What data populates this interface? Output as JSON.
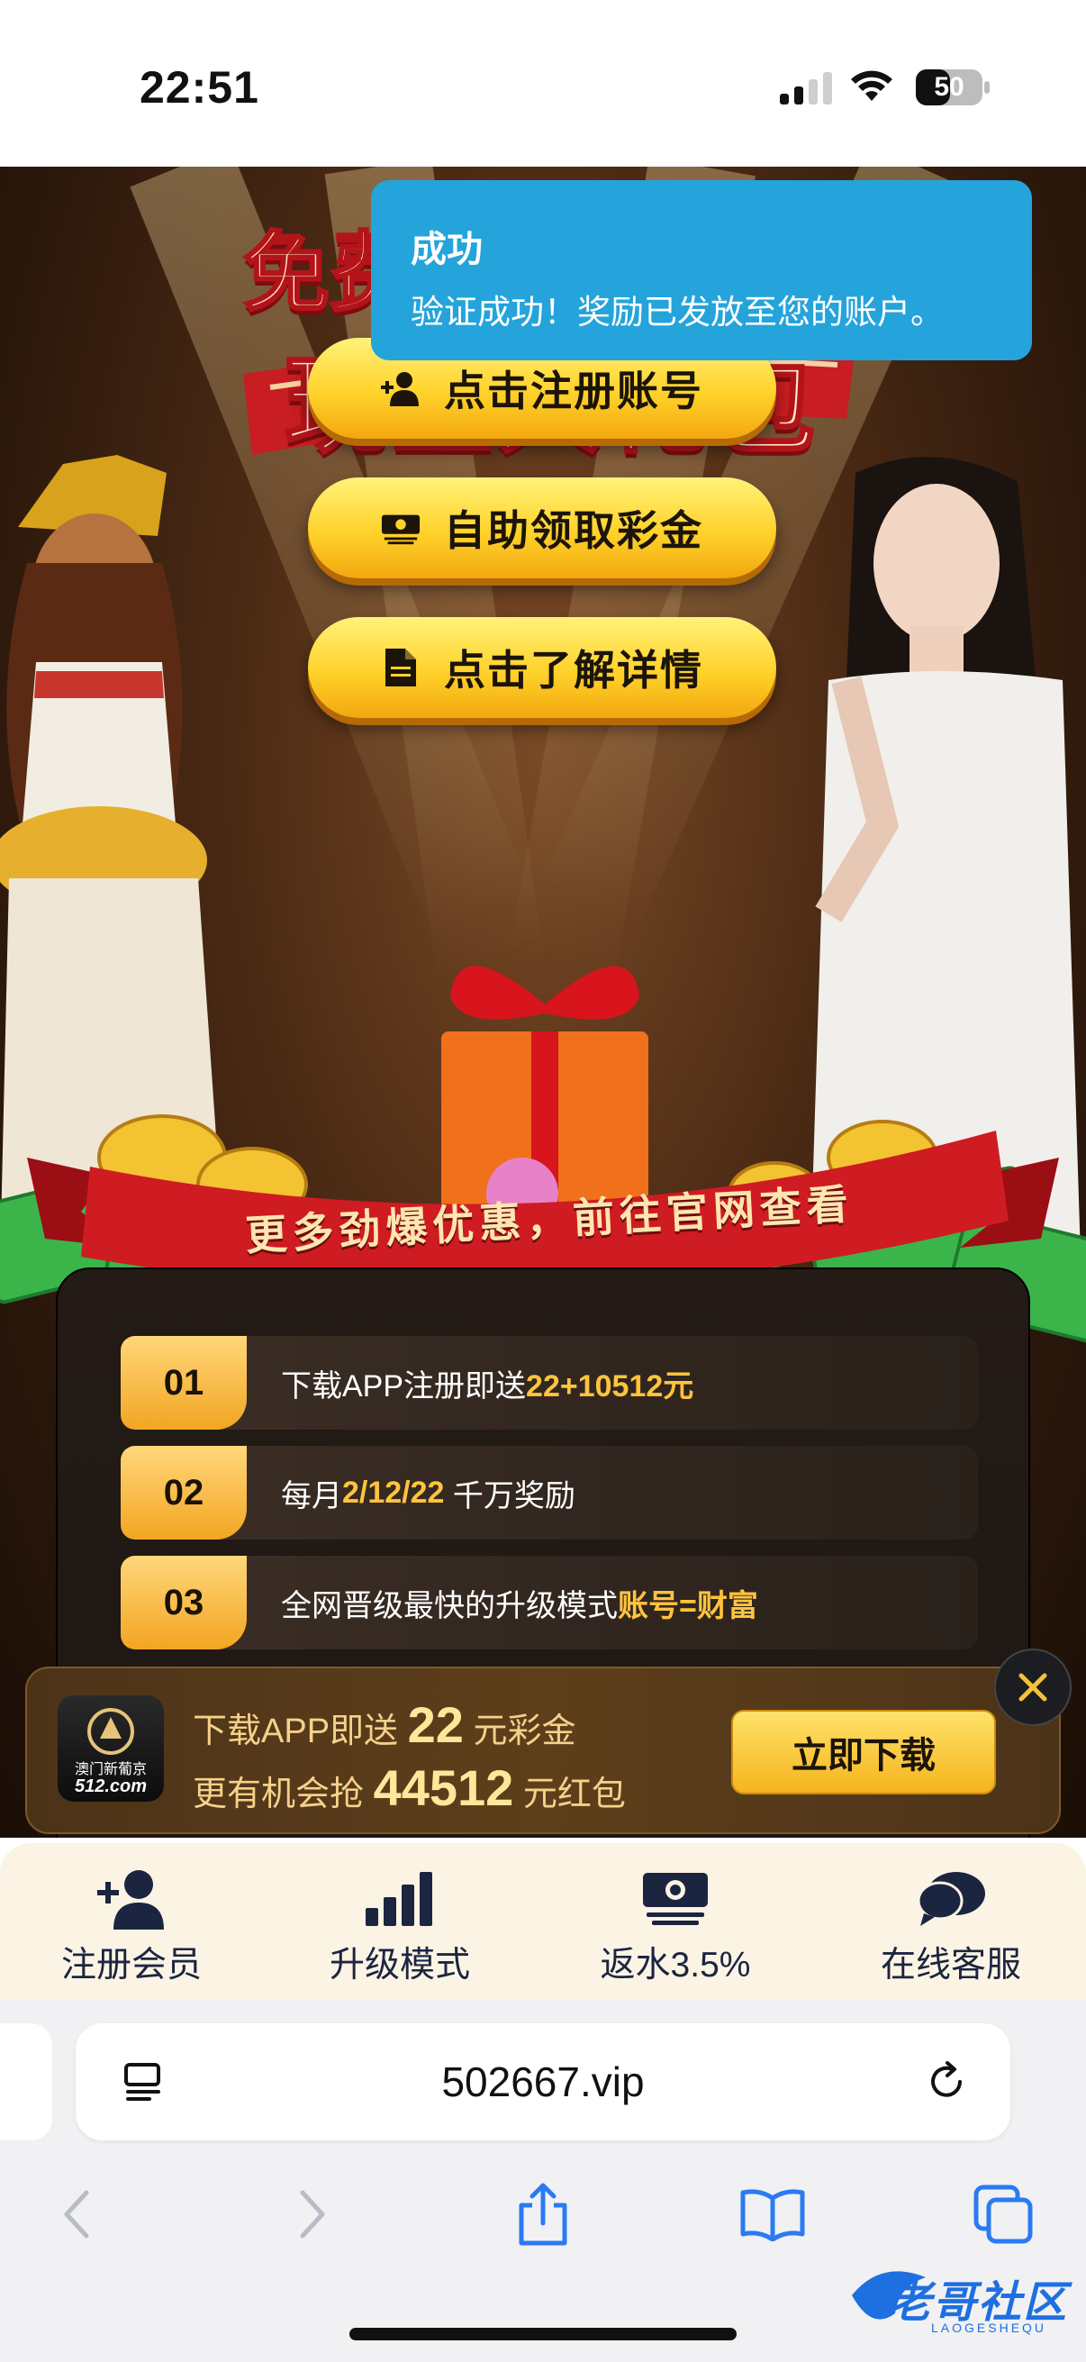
{
  "status_bar": {
    "time": "22:51",
    "battery": "50"
  },
  "hero": {
    "title_line1": "免费",
    "title_line2": "现金大礼包",
    "buttons": [
      {
        "label": "点击注册账号",
        "icon": "add-user-icon"
      },
      {
        "label": "自助领取彩金",
        "icon": "cash-icon"
      },
      {
        "label": "点击了解详情",
        "icon": "document-icon"
      }
    ],
    "banner_text": "更多劲爆优惠，前往官网查看"
  },
  "promo_list": [
    {
      "num": "01",
      "text": "下载APP注册即送 ",
      "highlight": "22+10512元",
      "suffix": ""
    },
    {
      "num": "02",
      "text": "每月",
      "highlight": "2/12/22",
      "suffix": " 千万奖励"
    },
    {
      "num": "03",
      "text": "全网晋级最快的升级模式 ",
      "highlight": "账号=财富",
      "suffix": ""
    }
  ],
  "toast": {
    "title": "成功",
    "message": "验证成功！奖励已发放至您的账户。"
  },
  "download_bar": {
    "logo_text": "澳门新葡京",
    "logo_sub": "512.com",
    "line1_prefix": "下载APP即送",
    "line1_amount": "22",
    "line1_suffix": "元彩金",
    "line2_prefix": "更有机会抢",
    "line2_amount": "44512",
    "line2_suffix": "元红包",
    "button": "立即下载",
    "close_icon": "close-icon"
  },
  "bottom_nav": [
    {
      "label": "注册会员",
      "icon": "add-user-icon"
    },
    {
      "label": "升级模式",
      "icon": "bar-chart-icon"
    },
    {
      "label": "返水3.5%",
      "icon": "cash-icon"
    },
    {
      "label": "在线客服",
      "icon": "chat-icon"
    }
  ],
  "browser": {
    "url": "502667.vip",
    "toolbar": [
      "back-icon",
      "forward-icon",
      "share-icon",
      "bookmarks-icon",
      "tabs-icon"
    ]
  },
  "watermark": {
    "text": "老哥社区",
    "sub": "LAOGESHEQU"
  },
  "colors": {
    "toast": "#24a4da",
    "cta_gold": "#ffd22a",
    "highlight": "#ffc43c",
    "nav_bg": "#fbf4e4",
    "nav_text": "#1c2540"
  }
}
